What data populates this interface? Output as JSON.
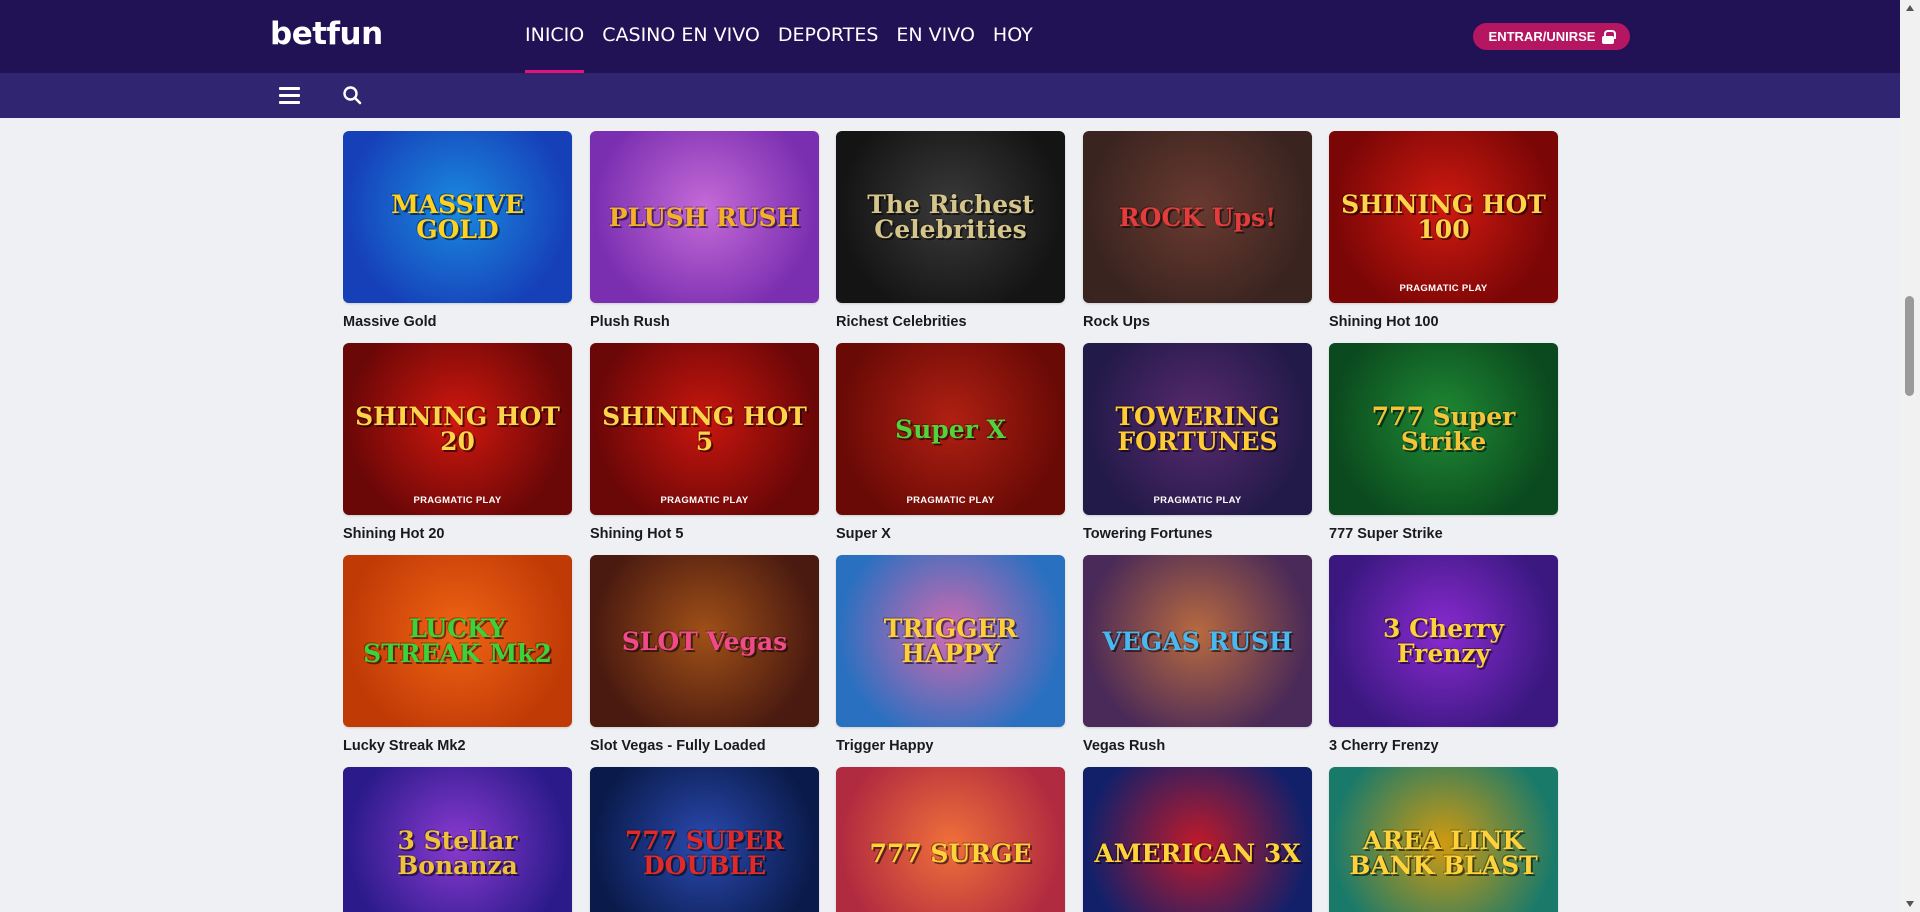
{
  "header": {
    "logo": "betfun",
    "nav": [
      {
        "label": "INICIO",
        "active": true
      },
      {
        "label": "CASINO EN VIVO",
        "active": false
      },
      {
        "label": "DEPORTES",
        "active": false
      },
      {
        "label": "EN VIVO",
        "active": false
      },
      {
        "label": "HOY",
        "active": false
      }
    ],
    "login_label": "ENTRAR/UNIRSE"
  },
  "games": [
    {
      "title": "Massive Gold",
      "art": "MASSIVE GOLD",
      "provider": "",
      "bg": "#1640b8",
      "bg2": "#1a8ae0",
      "fg": "#ffd21f"
    },
    {
      "title": "Plush Rush",
      "art": "PLUSH RUSH",
      "provider": "",
      "bg": "#7a2fb0",
      "bg2": "#c66ad8",
      "fg": "#f5b02a"
    },
    {
      "title": "Richest Celebrities",
      "art": "The Richest Celebrities",
      "provider": "",
      "bg": "#141414",
      "bg2": "#3a3a3a",
      "fg": "#d6c58a"
    },
    {
      "title": "Rock Ups",
      "art": "ROCK Ups!",
      "provider": "",
      "bg": "#3a2420",
      "bg2": "#6a3a30",
      "fg": "#e33c3c"
    },
    {
      "title": "Shining Hot 100",
      "art": "SHINING HOT 100",
      "provider": "PRAGMATIC PLAY",
      "bg": "#7a0606",
      "bg2": "#d01a10",
      "fg": "#ffd34a"
    },
    {
      "title": "Shining Hot 20",
      "art": "SHINING HOT 20",
      "provider": "PRAGMATIC PLAY",
      "bg": "#6a0707",
      "bg2": "#d0180e",
      "fg": "#ffd34a"
    },
    {
      "title": "Shining Hot 5",
      "art": "SHINING HOT 5",
      "provider": "PRAGMATIC PLAY",
      "bg": "#6a0707",
      "bg2": "#c9160e",
      "fg": "#ffd34a"
    },
    {
      "title": "Super X",
      "art": "Super X",
      "provider": "PRAGMATIC PLAY",
      "bg": "#6a0a06",
      "bg2": "#b02012",
      "fg": "#52d23c"
    },
    {
      "title": "Towering Fortunes",
      "art": "TOWERING FORTUNES",
      "provider": "PRAGMATIC PLAY",
      "bg": "#221a48",
      "bg2": "#5a2a70",
      "fg": "#ffcc33"
    },
    {
      "title": "777 Super Strike",
      "art": "777 Super Strike",
      "provider": "",
      "bg": "#0b4a1e",
      "bg2": "#1f8a34",
      "fg": "#f2c43a"
    },
    {
      "title": "Lucky Streak Mk2",
      "art": "LUCKY STREAK Mk2",
      "provider": "",
      "bg": "#c03a06",
      "bg2": "#f06414",
      "fg": "#3ed23a"
    },
    {
      "title": "Slot Vegas - Fully Loaded",
      "art": "SLOT Vegas",
      "provider": "",
      "bg": "#4a1a10",
      "bg2": "#a05018",
      "fg": "#f04a8a"
    },
    {
      "title": "Trigger Happy",
      "art": "TRIGGER HAPPY",
      "provider": "",
      "bg": "#2a70c0",
      "bg2": "#d06ab0",
      "fg": "#ffcf3a"
    },
    {
      "title": "Vegas Rush",
      "art": "VEGAS RUSH",
      "provider": "",
      "bg": "#4a2a58",
      "bg2": "#b86a40",
      "fg": "#4ab8f0"
    },
    {
      "title": "3 Cherry Frenzy",
      "art": "3 Cherry Frenzy",
      "provider": "",
      "bg": "#3a1880",
      "bg2": "#8a2ad0",
      "fg": "#ffd23a"
    },
    {
      "title": "",
      "art": "3 Stellar Bonanza",
      "provider": "",
      "bg": "#2a1a8a",
      "bg2": "#8a3ad0",
      "fg": "#f0c23a"
    },
    {
      "title": "",
      "art": "777 SUPER DOUBLE",
      "provider": "",
      "bg": "#0a1a4a",
      "bg2": "#2a4ab0",
      "fg": "#e02a2a"
    },
    {
      "title": "",
      "art": "777 SURGE",
      "provider": "",
      "bg": "#b02a40",
      "bg2": "#f0703a",
      "fg": "#ffd23a"
    },
    {
      "title": "",
      "art": "AMERICAN 3X",
      "provider": "",
      "bg": "#12206a",
      "bg2": "#c01a2a",
      "fg": "#ffd23a"
    },
    {
      "title": "",
      "art": "AREA LINK BANK BLAST",
      "provider": "",
      "bg": "#1a7a6a",
      "bg2": "#d09a10",
      "fg": "#ffd23a"
    }
  ]
}
